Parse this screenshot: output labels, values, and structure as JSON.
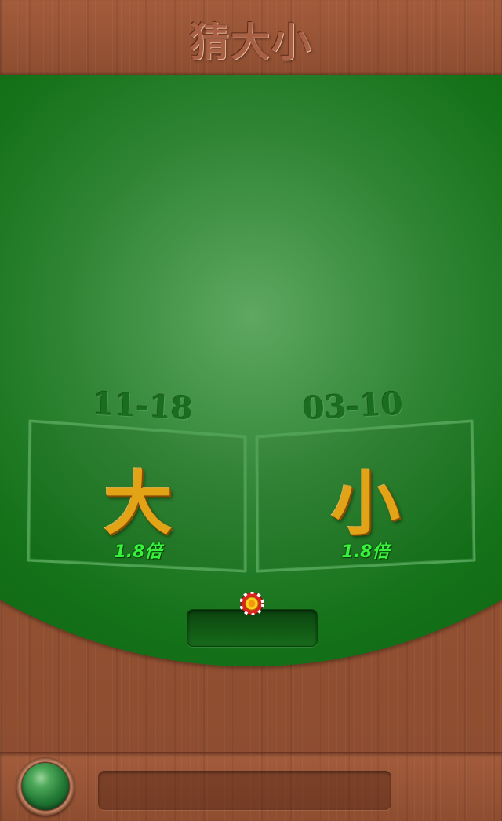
{
  "header": {
    "title": "猜大小"
  },
  "table": {
    "big": {
      "range": "11-18",
      "label": "大",
      "odds": "1.8倍"
    },
    "small": {
      "range": "03-10",
      "label": "小",
      "odds": "1.8倍"
    },
    "bet_amount": ""
  },
  "footer": {
    "message": ""
  },
  "colors": {
    "felt": "#0b5f0f",
    "wood": "#9a5637",
    "bet_char": "#e3a316",
    "odds_text": "#38f23c"
  },
  "icons": {
    "chip": "poker-chip-icon",
    "menu": "green-round-button"
  }
}
